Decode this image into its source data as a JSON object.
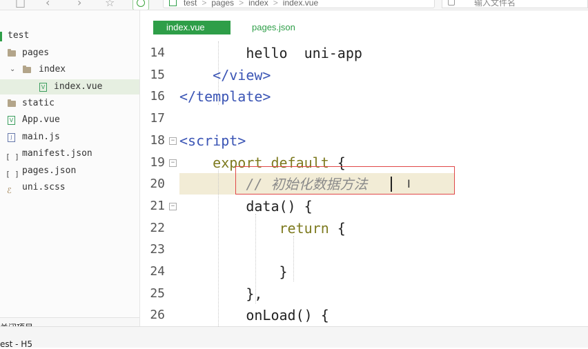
{
  "breadcrumb": [
    "test",
    "pages",
    "index",
    "index.vue"
  ],
  "search": {
    "placeholder": "输入文件名"
  },
  "tree": [
    {
      "label": "test"
    },
    {
      "label": "pages"
    },
    {
      "label": "index"
    },
    {
      "label": "index.vue"
    },
    {
      "label": "static"
    },
    {
      "label": "App.vue"
    },
    {
      "label": "main.js"
    },
    {
      "label": "manifest.json"
    },
    {
      "label": "pages.json"
    },
    {
      "label": "uni.scss"
    }
  ],
  "sidebar_footer": "关闭项目",
  "tabs": [
    "index.vue",
    "pages.json"
  ],
  "status": "est - H5",
  "code": [
    {
      "n": "14",
      "fold": false,
      "parts": [
        [
          "",
          "        hello  uni-app"
        ]
      ]
    },
    {
      "n": "15",
      "fold": false,
      "parts": [
        [
          "",
          "    "
        ],
        [
          "tag",
          "</view>"
        ]
      ]
    },
    {
      "n": "16",
      "fold": false,
      "parts": [
        [
          "tag",
          "</template>"
        ]
      ]
    },
    {
      "n": "17",
      "fold": false,
      "parts": [
        [
          "",
          ""
        ]
      ]
    },
    {
      "n": "18",
      "fold": true,
      "parts": [
        [
          "tag",
          "<script>"
        ]
      ]
    },
    {
      "n": "19",
      "fold": true,
      "parts": [
        [
          "",
          "    "
        ],
        [
          "kw",
          "export default"
        ],
        [
          "",
          " {"
        ]
      ]
    },
    {
      "n": "20",
      "fold": false,
      "parts": [
        [
          "",
          "        "
        ],
        [
          "cm",
          "// 初始化数据方法"
        ]
      ]
    },
    {
      "n": "21",
      "fold": true,
      "parts": [
        [
          "",
          "        data() {"
        ]
      ]
    },
    {
      "n": "22",
      "fold": false,
      "parts": [
        [
          "",
          "            "
        ],
        [
          "kw",
          "return"
        ],
        [
          "",
          " {"
        ]
      ]
    },
    {
      "n": "23",
      "fold": false,
      "parts": [
        [
          "",
          ""
        ]
      ]
    },
    {
      "n": "24",
      "fold": false,
      "parts": [
        [
          "",
          "            }"
        ]
      ]
    },
    {
      "n": "25",
      "fold": false,
      "parts": [
        [
          "",
          "        },"
        ]
      ]
    },
    {
      "n": "26",
      "fold": false,
      "parts": [
        [
          "",
          "        onLoad() {"
        ]
      ]
    }
  ]
}
